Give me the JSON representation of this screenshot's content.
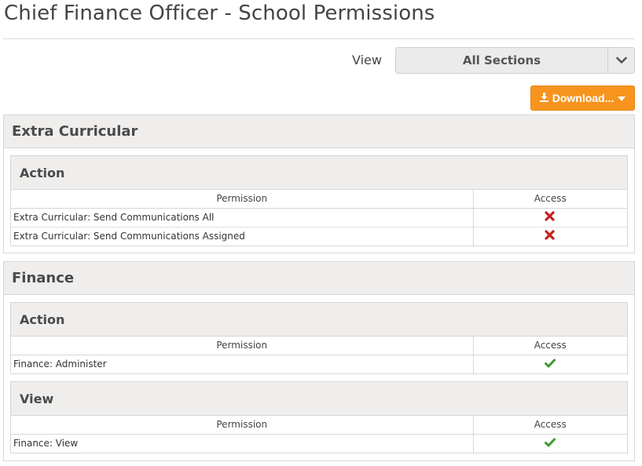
{
  "page": {
    "title": "Chief Finance Officer - School Permissions"
  },
  "view_filter": {
    "label": "View",
    "selected": "All Sections"
  },
  "download": {
    "label": "Download..."
  },
  "table_headers": {
    "permission": "Permission",
    "access": "Access"
  },
  "colors": {
    "accent": "#f7941d",
    "deny": "#c0241c",
    "allow": "#3c9a2e",
    "panel": "#efeeed"
  },
  "sections": [
    {
      "title": "Extra Curricular",
      "groups": [
        {
          "title": "Action",
          "rows": [
            {
              "permission": "Extra Curricular: Send Communications All",
              "access": "denied",
              "icon": "cross-icon"
            },
            {
              "permission": "Extra Curricular: Send Communications Assigned",
              "access": "denied",
              "icon": "cross-icon"
            }
          ]
        }
      ]
    },
    {
      "title": "Finance",
      "groups": [
        {
          "title": "Action",
          "rows": [
            {
              "permission": "Finance: Administer",
              "access": "allowed",
              "icon": "check-icon"
            }
          ]
        },
        {
          "title": "View",
          "rows": [
            {
              "permission": "Finance: View",
              "access": "allowed",
              "icon": "check-icon"
            }
          ]
        }
      ]
    }
  ]
}
